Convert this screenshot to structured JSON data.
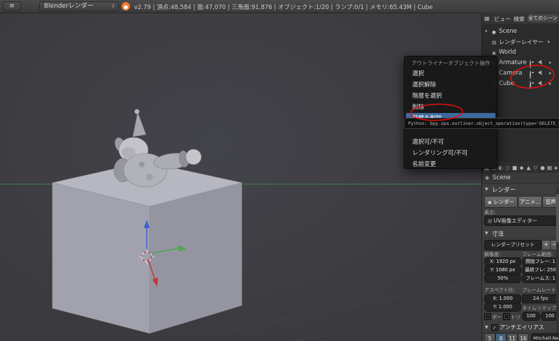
{
  "colors": {
    "accent_highlight": "#3d6a9f",
    "annotation_red": "#e01010",
    "axis_x": "#c03535",
    "axis_y": "#55a555",
    "axis_z": "#3c5fd0",
    "blender_orange": "#f5792a"
  },
  "header": {
    "engine": "Blenderレンダー",
    "stats": "v2.79 | 頂点:48,584 | 面:47,070 | 三角面:91,876 | オブジェクト:1/20 | ランプ:0/1 | メモリ:65.43M | Cube"
  },
  "icons": {
    "editor_type": "≡",
    "updown": "↕",
    "section_open": "▼",
    "tree_open": "▾",
    "tree_closed": "▸",
    "plus": "+",
    "minus": "−",
    "check": "✓",
    "grid": "▦",
    "breadcrumb_scene": "◉",
    "render_image": "▣",
    "anim_play": "▶",
    "audio_note": "♪",
    "display_editor": "▤"
  },
  "outliner": {
    "menu_view": "ビュー",
    "menu_search": "検索",
    "display_mode": "全てのシーン",
    "tree": [
      {
        "icon": "●",
        "label": "Scene"
      },
      {
        "icon": "▤",
        "label": "レンダーレイヤー"
      },
      {
        "icon": "◉",
        "label": "World"
      },
      {
        "icon": "⊕",
        "label": "Armature"
      },
      {
        "icon": "◆",
        "label": "Camera"
      },
      {
        "icon": "▣",
        "label": "Cube"
      }
    ]
  },
  "context_menu": {
    "title": "アウトライナーオブジェクト操作",
    "items": [
      "選択",
      "選択解除",
      "階層を選択",
      "削除",
      "階層を削除",
      "選択可/不可",
      "レンダリング可/不可",
      "名前変更"
    ],
    "highlighted_item": "階層を削除",
    "tooltip": "Python: bpy.ops.outliner.object_operation(type='DELETE_HIERARCHY')"
  },
  "properties": {
    "tabs": [
      {
        "name": "render",
        "glyph": "▣"
      },
      {
        "name": "render-layers",
        "glyph": "▤"
      },
      {
        "name": "scene",
        "glyph": "◐"
      },
      {
        "name": "world",
        "glyph": "○"
      },
      {
        "name": "object",
        "glyph": "■"
      },
      {
        "name": "constraints",
        "glyph": "◆"
      },
      {
        "name": "modifiers",
        "glyph": "▲"
      },
      {
        "name": "data",
        "glyph": "▽"
      },
      {
        "name": "material",
        "glyph": "●"
      },
      {
        "name": "texture",
        "glyph": "▦"
      },
      {
        "name": "particles",
        "glyph": "◈"
      }
    ],
    "breadcrumb": "Scene",
    "render": {
      "section_title": "レンダー",
      "render_button": "レンダー",
      "anim_button": "アニメ...",
      "audio_button": "音声",
      "display_label": "表示:",
      "display_value": "UV画像エディター"
    },
    "dimensions": {
      "section_title": "寸法",
      "preset": "レンダープリセット",
      "resolution_label": "解像度:",
      "frame_range_label": "フレーム範囲:",
      "res_x": "X: 1920 px",
      "res_y": "Y: 1080 px",
      "res_scale": "50%",
      "frame_start": "開始フレー: 1",
      "frame_end": "最終フレ: 250",
      "frame_step": "フレームス: 1",
      "aspect_label": "アスペクト比:",
      "framerate_label": "フレームレート:",
      "aspect_x": "X: 1.000",
      "aspect_y": "Y: 1.000",
      "fps": "24 fps",
      "time_remap_label": "タイムリマップ",
      "border_label": "ボー",
      "crop_label": "トリ",
      "remap_old": "100",
      "remap_new": "100"
    },
    "antialiasing": {
      "section_title": "アンチエイリアス",
      "checked": true,
      "samples": [
        "5",
        "8",
        "11",
        "16"
      ],
      "active_sample": "8",
      "filter": "Mitchell-Netrav"
    }
  }
}
